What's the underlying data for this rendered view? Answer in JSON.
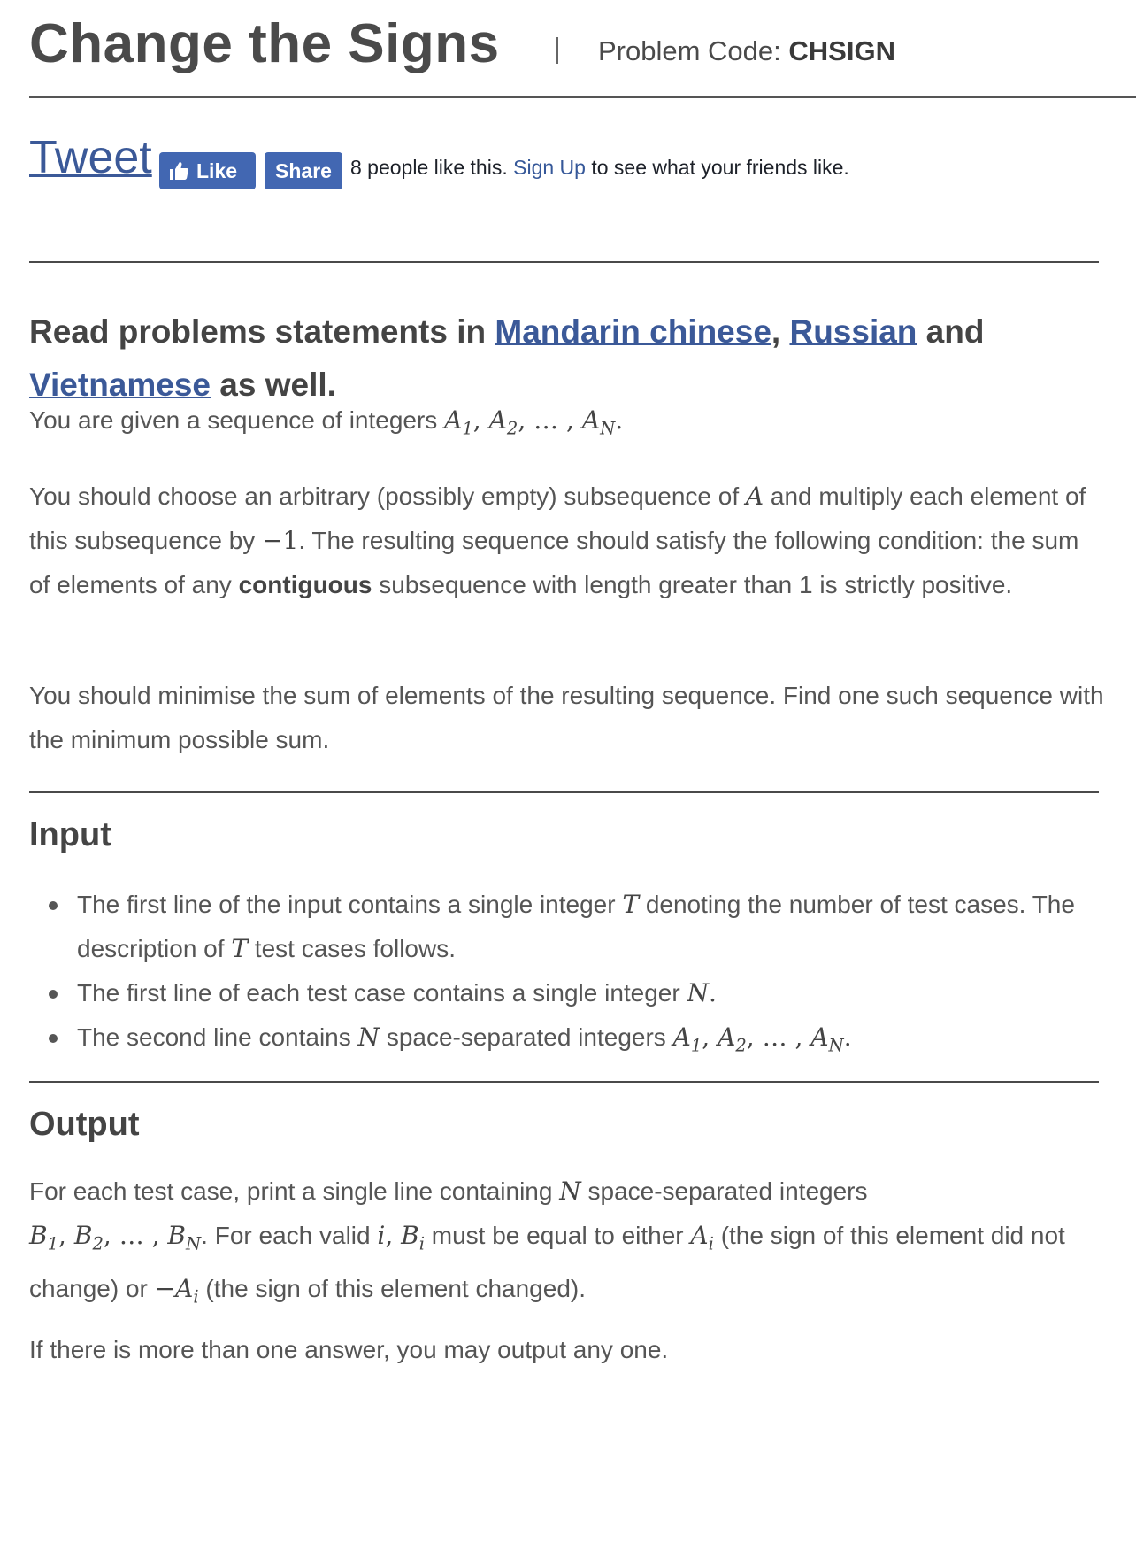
{
  "header": {
    "title": "Change the Signs",
    "code_label": "Problem Code: ",
    "code_value": "CHSIGN"
  },
  "social": {
    "tweet": "Tweet",
    "like": "Like",
    "share": "Share",
    "likes_text": "8 people like this.",
    "signup": "Sign Up",
    "friends_text": "to see what your friends like."
  },
  "intro": {
    "read": "Read problems statements in ",
    "mandarin": "Mandarin chinese",
    "comma": ", ",
    "russian": "Russian",
    "and": " and",
    "vietnamese": "Vietnamese",
    "as_well": " as well."
  },
  "statement": {
    "p1": "You are given a sequence of integers",
    "p2a": "You should choose an arbitrary (possibly empty) subsequence of",
    "p2b": "and multiply each element of this subsequence by",
    "p2c": ". The resulting sequence should satisfy the following condition: the sum of elements of any",
    "p2bold": "contiguous",
    "p2d": "subsequence with length greater than 1 is strictly positive.",
    "p3": "You should minimise the sum of elements of the resulting sequence. Find one such sequence with the minimum possible sum."
  },
  "input": {
    "heading": "Input",
    "i1a": "The first line of the input contains a single integer",
    "i1b": "denoting the number of test cases. The description of",
    "i1c": "test cases follows.",
    "i2": "The first line of each test case contains a single integer",
    "i3a": "The second line contains",
    "i3b": "space-separated integers"
  },
  "output": {
    "heading": "Output",
    "o1a": "For each test case, print a single line containing",
    "o1b": "space-separated integers",
    "o1c": ". For each valid",
    "o1d": "must be equal to either",
    "o1e": "(the sign of this element did not change) or",
    "o1f": "(the sign of this element changed).",
    "o2": "If there is more than one answer, you may output any one."
  }
}
